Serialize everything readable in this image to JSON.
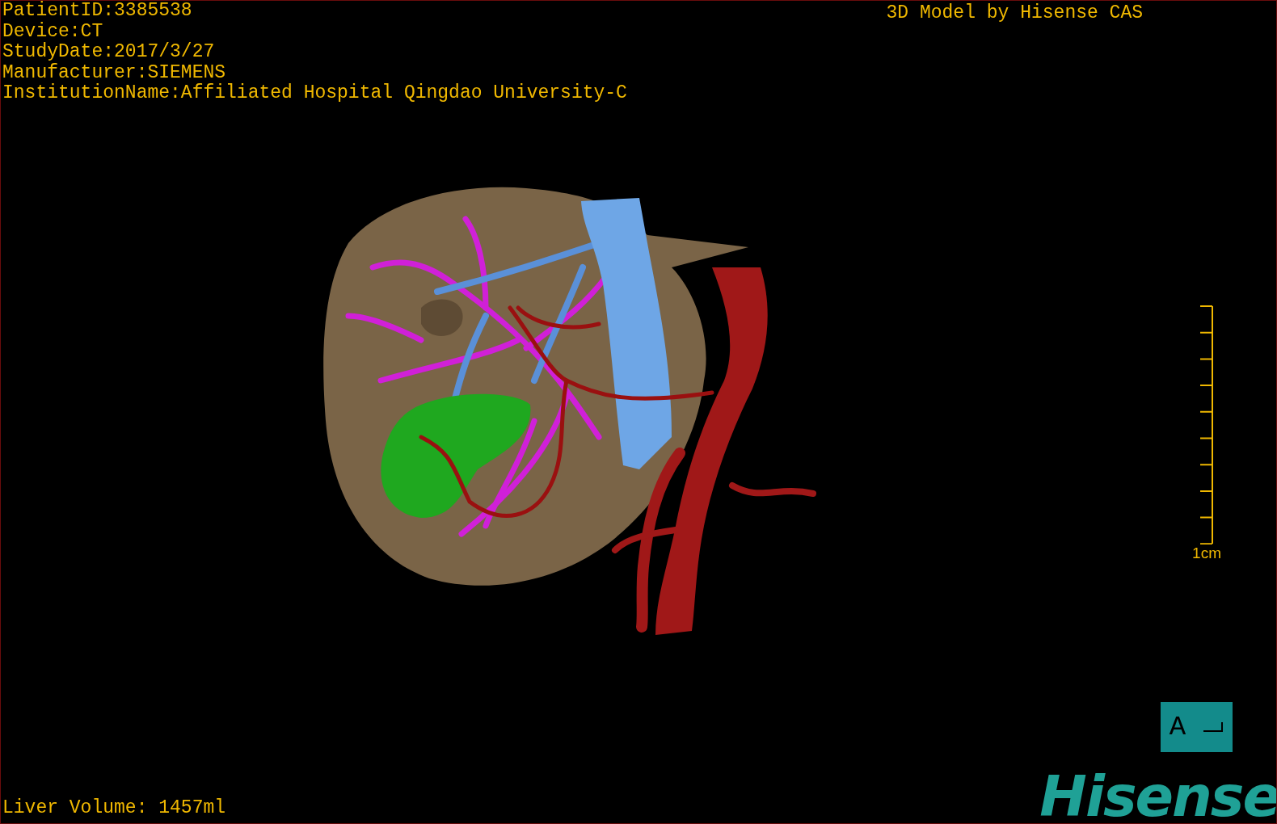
{
  "overlay": {
    "info_lines": [
      "PatientID:3385538",
      "Device:CT",
      "StudyDate:2017/3/27",
      "Manufacturer:SIEMENS",
      "InstitutionName:Affiliated Hospital Qingdao University-C"
    ],
    "title": "3D Model by Hisense CAS",
    "scale_label": "1cm",
    "orientation_label": "A",
    "volume": "Liver Volume: 1457ml",
    "logo": "Hisense"
  }
}
